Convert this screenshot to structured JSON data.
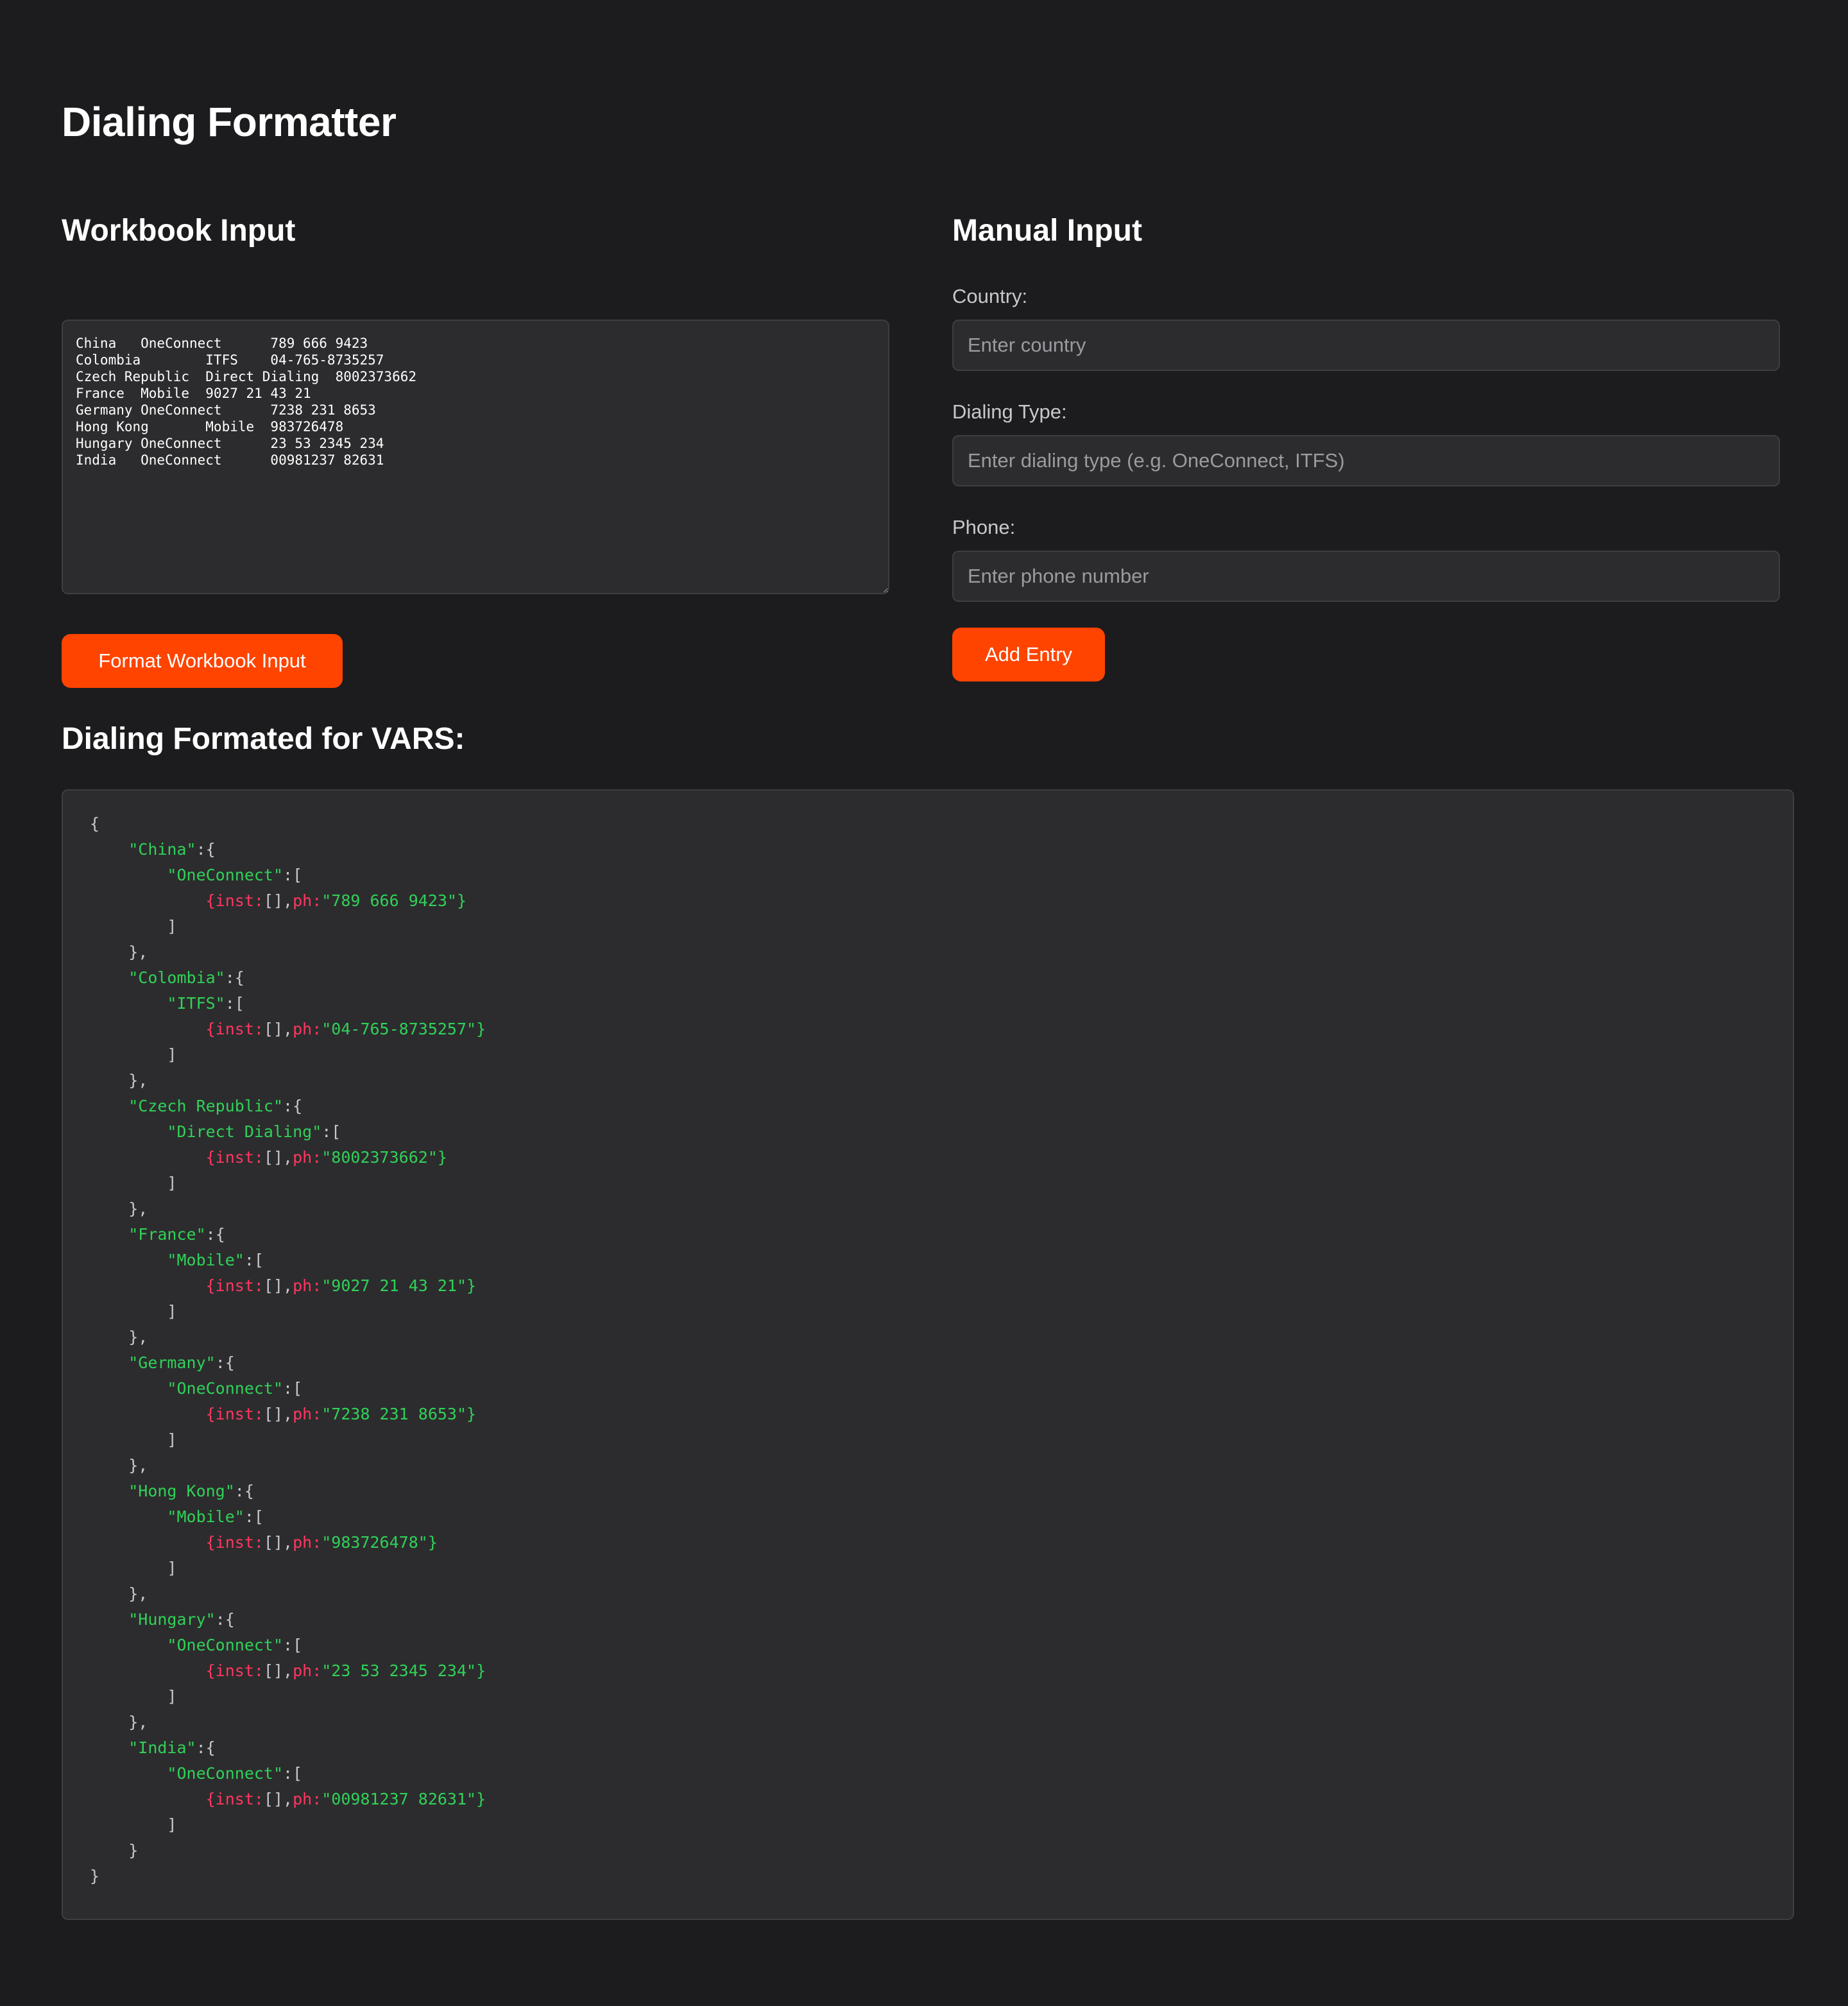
{
  "page": {
    "title": "Dialing Formatter"
  },
  "workbook": {
    "title": "Workbook Input",
    "text": "China   OneConnect      789 666 9423\nColombia        ITFS    04-765-8735257\nCzech Republic  Direct Dialing  8002373662\nFrance  Mobile  9027 21 43 21\nGermany OneConnect      7238 231 8653\nHong Kong       Mobile  983726478\nHungary OneConnect      23 53 2345 234\nIndia   OneConnect      00981237 82631",
    "button_label": "Format Workbook Input"
  },
  "manual": {
    "title": "Manual Input",
    "country_label": "Country:",
    "country_placeholder": "Enter country",
    "country_value": "",
    "type_label": "Dialing Type:",
    "type_placeholder": "Enter dialing type (e.g. OneConnect, ITFS)",
    "type_value": "",
    "phone_label": "Phone:",
    "phone_placeholder": "Enter phone number",
    "phone_value": "",
    "button_label": "Add Entry"
  },
  "output": {
    "title": "Dialing Formated for VARS:",
    "entries": [
      {
        "country": "China",
        "type": "OneConnect",
        "phone": "789 666 9423"
      },
      {
        "country": "Colombia",
        "type": "ITFS",
        "phone": "04-765-8735257"
      },
      {
        "country": "Czech Republic",
        "type": "Direct Dialing",
        "phone": "8002373662"
      },
      {
        "country": "France",
        "type": "Mobile",
        "phone": "9027 21 43 21"
      },
      {
        "country": "Germany",
        "type": "OneConnect",
        "phone": "7238 231 8653"
      },
      {
        "country": "Hong Kong",
        "type": "Mobile",
        "phone": "983726478"
      },
      {
        "country": "Hungary",
        "type": "OneConnect",
        "phone": "23 53 2345 234"
      },
      {
        "country": "India",
        "type": "OneConnect",
        "phone": "00981237 82631"
      }
    ]
  },
  "colors": {
    "background": "#1c1c1e",
    "panel": "#2c2c2e",
    "accent": "#ff4400",
    "json_key": "#30d158",
    "json_attr": "#ff375f"
  }
}
